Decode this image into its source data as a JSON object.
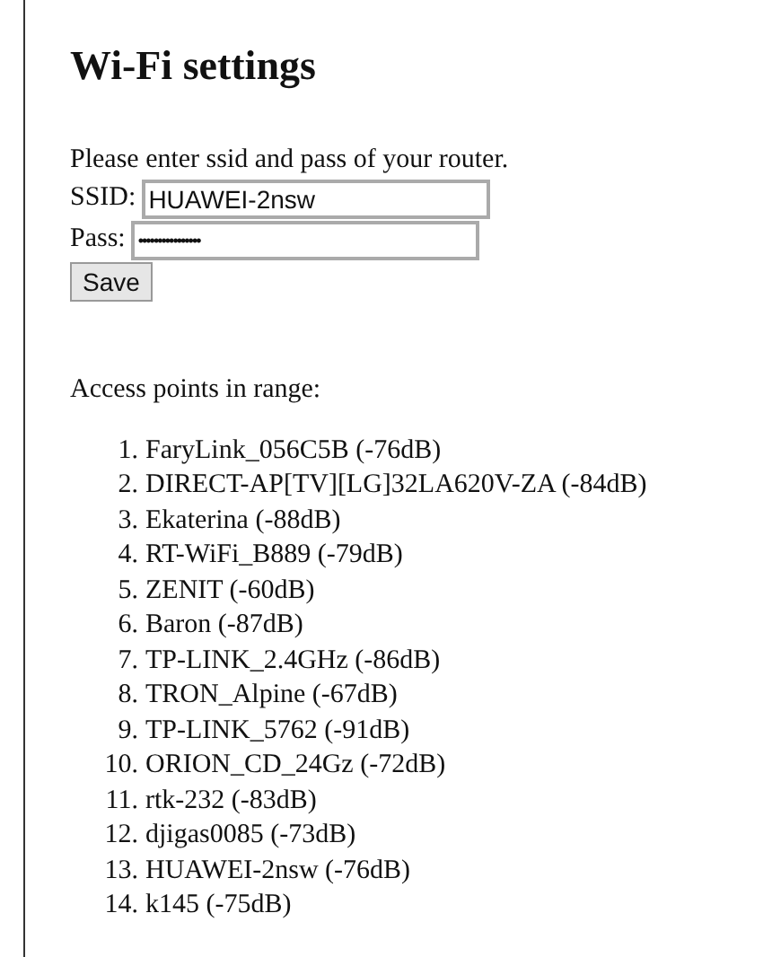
{
  "title": "Wi-Fi settings",
  "intro": "Please enter ssid and pass of your router.",
  "fields": [
    {
      "label": "SSID:",
      "value": "HUAWEI-2nsw",
      "kind": "text"
    },
    {
      "label": "Pass:",
      "value": "••••••••••••••••",
      "kind": "password"
    }
  ],
  "save_button": "Save",
  "access_points": {
    "heading": "Access points in range:",
    "items": [
      {
        "number": "1.",
        "text": "FaryLink_056C5B (-76dB)"
      },
      {
        "number": "2.",
        "text": "DIRECT-AP[TV][LG]32LA620V-ZA (-84dB)"
      },
      {
        "number": "3.",
        "text": "Ekaterina (-88dB)"
      },
      {
        "number": "4.",
        "text": "RT-WiFi_B889 (-79dB)"
      },
      {
        "number": "5.",
        "text": "ZENIT (-60dB)"
      },
      {
        "number": "6.",
        "text": "Baron (-87dB)"
      },
      {
        "number": "7.",
        "text": "TP-LINK_2.4GHz (-86dB)"
      },
      {
        "number": "8.",
        "text": "TRON_Alpine (-67dB)"
      },
      {
        "number": "9.",
        "text": "TP-LINK_5762 (-91dB)"
      },
      {
        "number": "10.",
        "text": "ORION_CD_24Gz (-72dB)"
      },
      {
        "number": "11.",
        "text": "rtk-232 (-83dB)"
      },
      {
        "number": "12.",
        "text": "djigas0085 (-73dB)"
      },
      {
        "number": "13.",
        "text": "HUAWEI-2nsw (-76dB)"
      },
      {
        "number": "14.",
        "text": "k145 (-75dB)"
      }
    ]
  }
}
